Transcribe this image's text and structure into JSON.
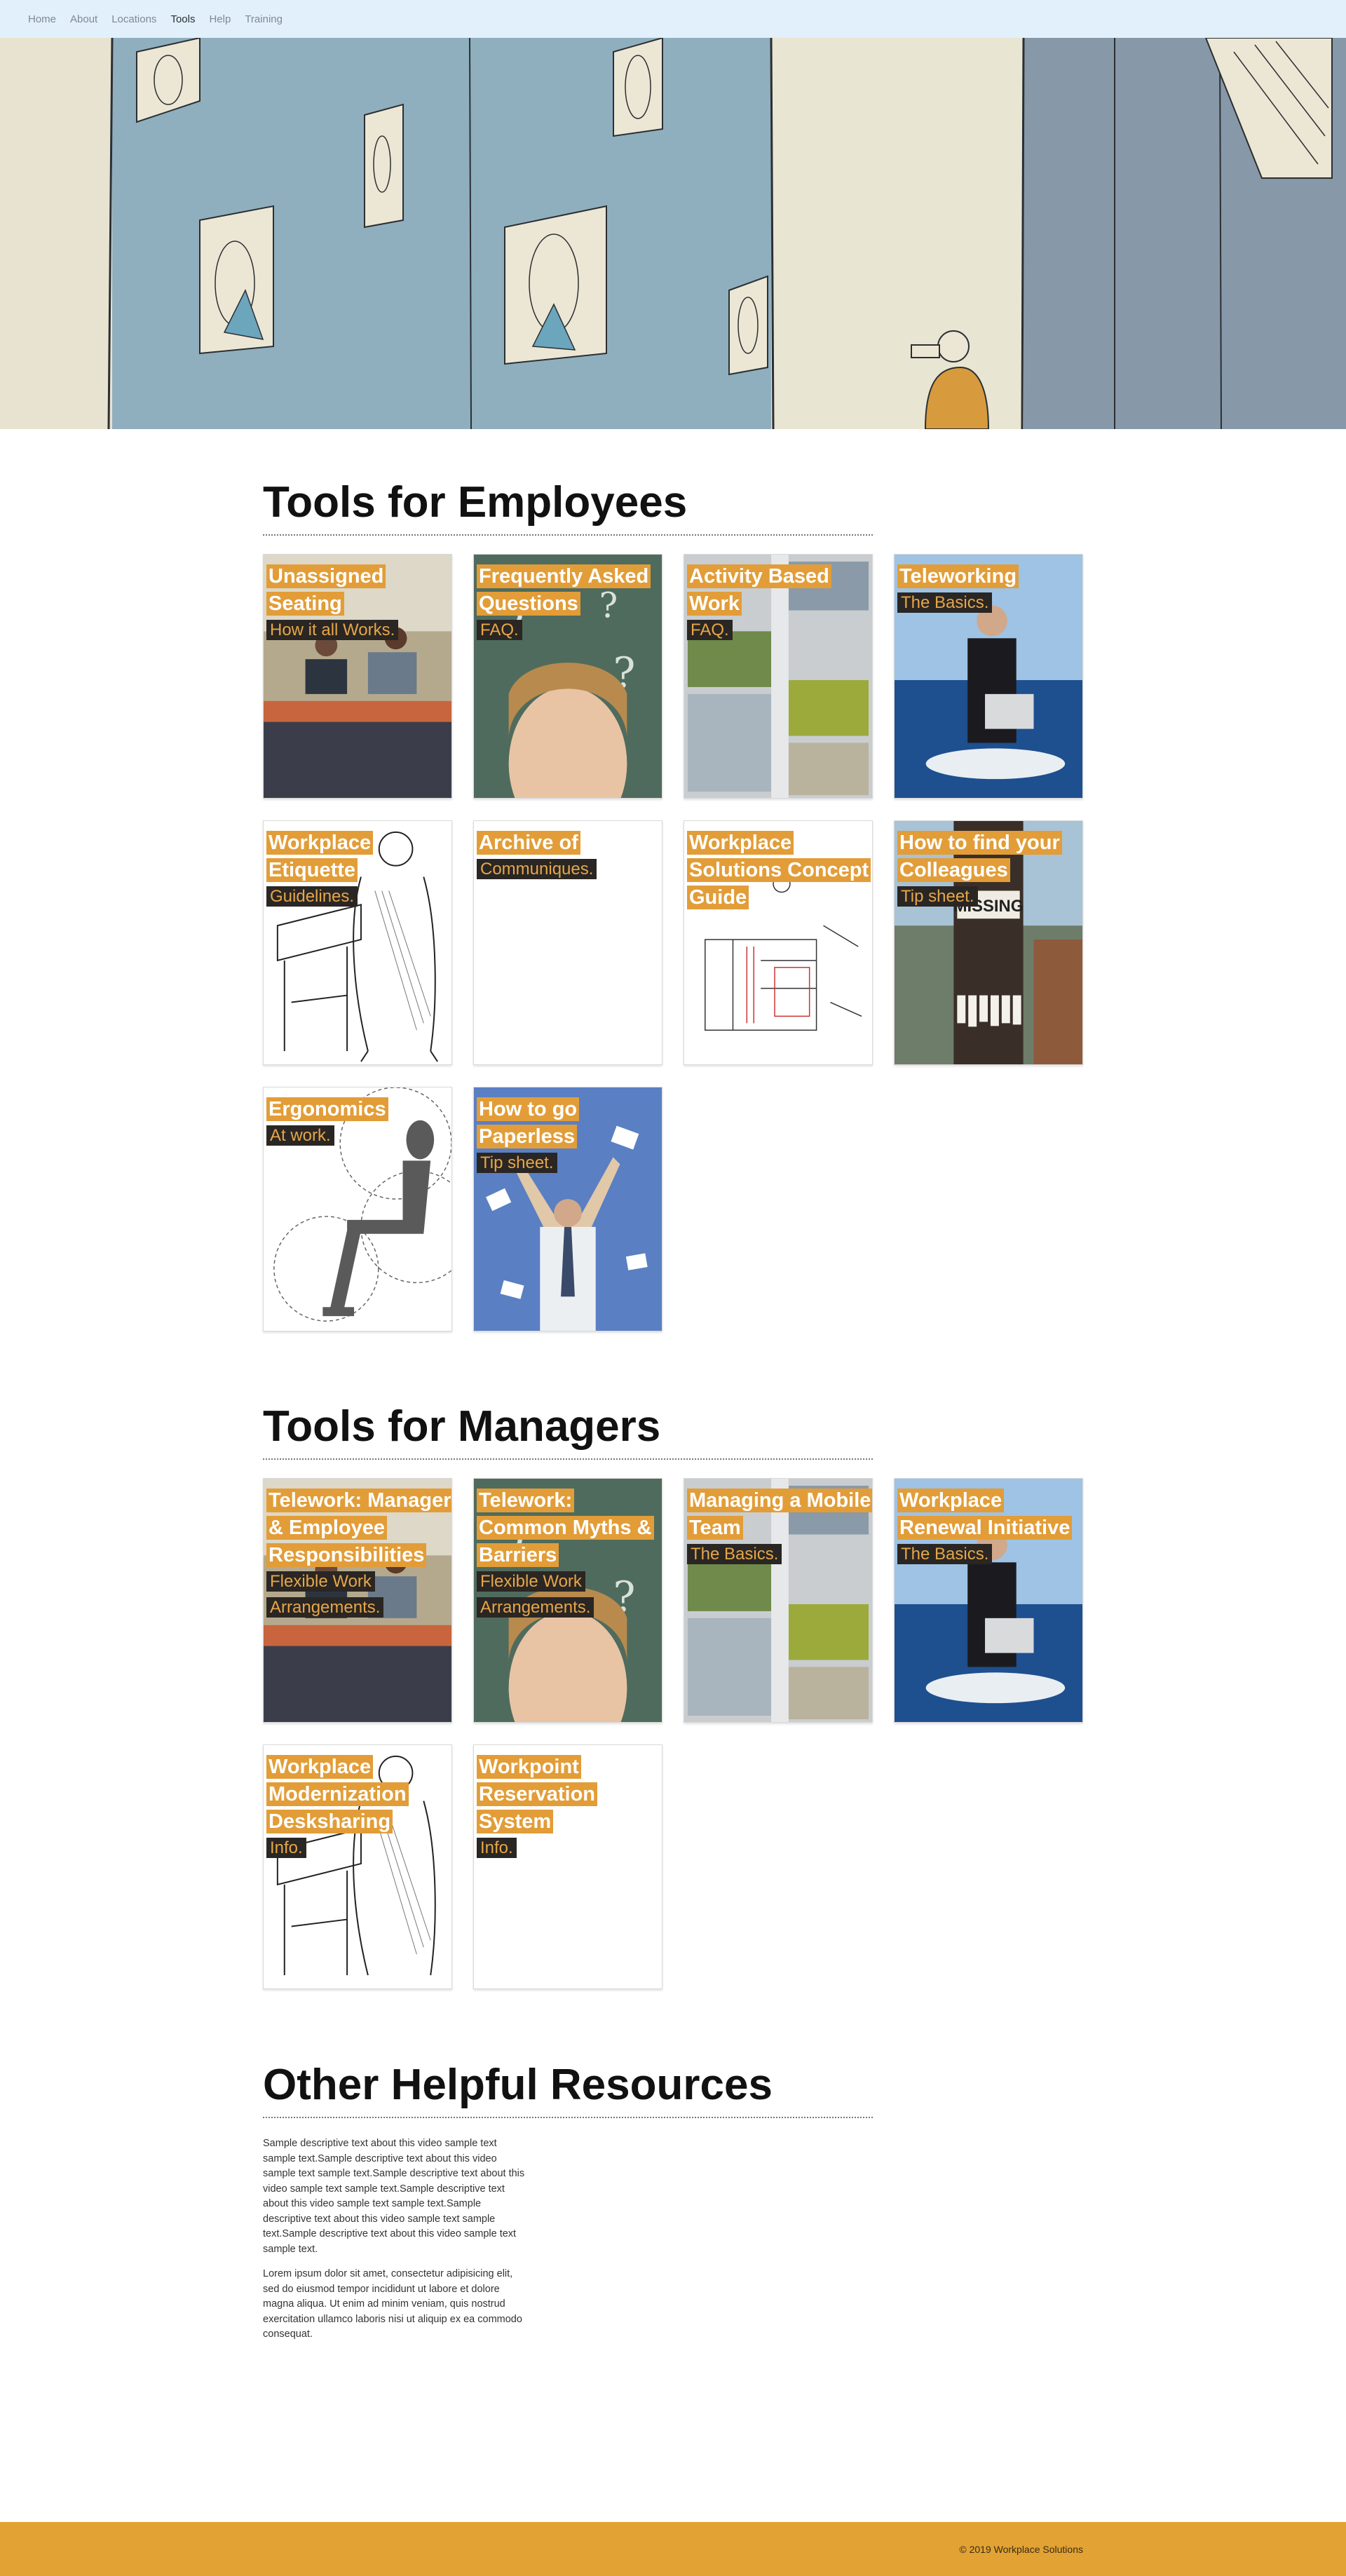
{
  "nav": {
    "items": [
      {
        "label": "Home"
      },
      {
        "label": "About"
      },
      {
        "label": "Locations"
      },
      {
        "label": "Tools"
      },
      {
        "label": "Help"
      },
      {
        "label": "Training"
      }
    ],
    "active": "Tools"
  },
  "employees": {
    "title": "Tools for Employees",
    "cards": [
      {
        "title": "Unassigned Seating",
        "sub": "How it all Works.",
        "image": "office-photo"
      },
      {
        "title": "Frequently Asked Questions",
        "sub": "FAQ.",
        "image": "thinking-woman"
      },
      {
        "title": "Activity Based Work",
        "sub": "FAQ.",
        "image": "office-collage"
      },
      {
        "title": "Teleworking",
        "sub": "The Basics.",
        "image": "businessman-on-sea"
      },
      {
        "title": "Workplace Etiquette",
        "sub": "Guidelines.",
        "image": "engraving-man-at-desk"
      },
      {
        "title": "Archive of",
        "sub": "Communiques.",
        "image": "blank"
      },
      {
        "title": "Workplace Solutions Concept Guide",
        "sub": "",
        "image": "floor-plan-sketch"
      },
      {
        "title": "How to find your Colleagues",
        "sub": "Tip sheet.",
        "image": "missing-poster-pole"
      },
      {
        "title": "Ergonomics",
        "sub": "At work.",
        "image": "ergonomic-figure"
      },
      {
        "title": "How to go Paperless",
        "sub": "Tip sheet.",
        "image": "flying-papers"
      }
    ]
  },
  "managers": {
    "title": "Tools for Managers",
    "cards": [
      {
        "title": "Telework: Manager & Employee Responsibilities",
        "sub": "Flexible Work Arrangements.",
        "image": "office-photo"
      },
      {
        "title": "Telework: Common Myths & Barriers",
        "sub": "Flexible Work Arrangements.",
        "image": "thinking-woman"
      },
      {
        "title": "Managing a Mobile Team",
        "sub": "The Basics.",
        "image": "office-collage"
      },
      {
        "title": "Workplace Renewal Initiative",
        "sub": "The Basics.",
        "image": "businessman-on-sea"
      },
      {
        "title": "Workplace Modernization Desksharing",
        "sub": "Info.",
        "image": "engraving-man-at-desk"
      },
      {
        "title": "Workpoint Reservation System",
        "sub": "Info.",
        "image": "blank"
      }
    ]
  },
  "resources": {
    "title": "Other Helpful Resources",
    "paragraphs": [
      "Sample descriptive text about this video sample text sample text.Sample descriptive text about this video sample text sample text.Sample descriptive text about this video sample text sample text.Sample descriptive text about this video sample text sample text.Sample descriptive text about this video sample text sample text.Sample descriptive text about this video sample text sample text.",
      "Lorem ipsum dolor sit amet, consectetur adipisicing elit, sed do eiusmod tempor incididunt ut labore et dolore magna aliqua. Ut enim ad minim veniam, quis nostrud exercitation ullamco laboris nisi ut aliquip ex ea commodo consequat."
    ]
  },
  "footer": {
    "text": "© 2019 Workplace Solutions"
  },
  "colors": {
    "accent": "#e29d38",
    "nav_bg": "#e2f0fb",
    "footer_bg": "#e2a234"
  }
}
